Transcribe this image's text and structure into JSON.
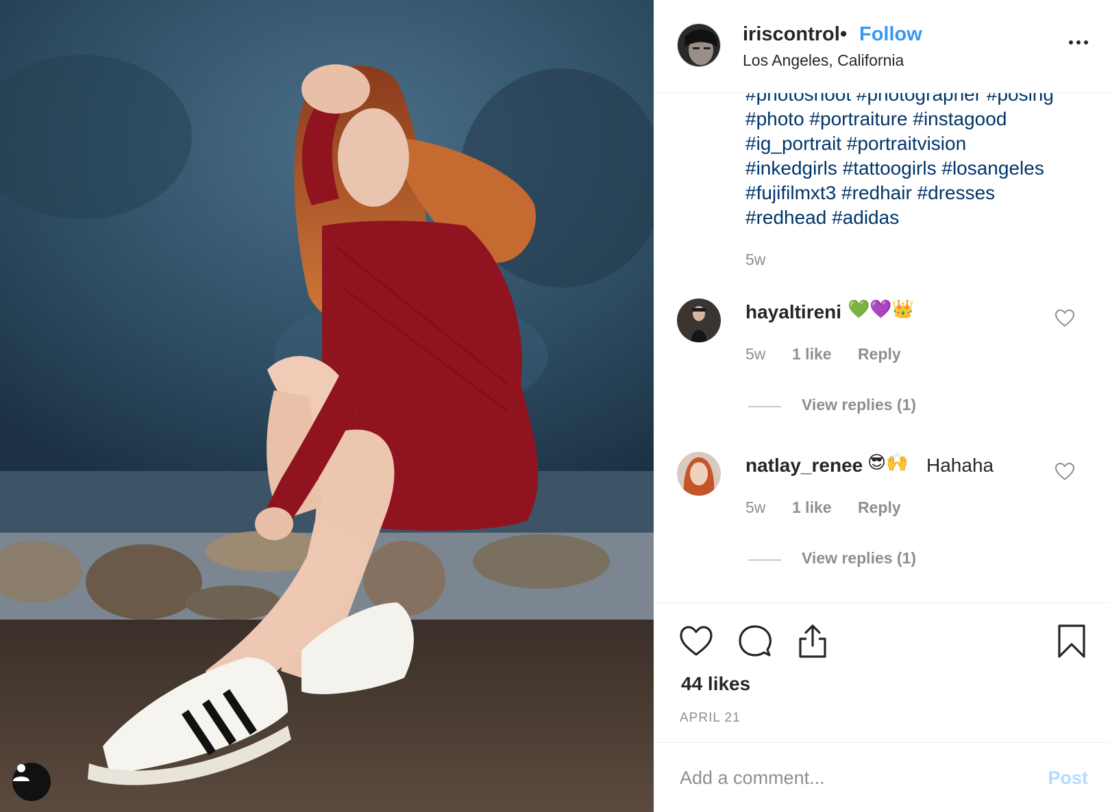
{
  "post": {
    "username": "iriscontrol",
    "separator": "•",
    "follow_label": "Follow",
    "location": "Los Angeles, California"
  },
  "caption": {
    "hashtags": [
      "#photoshoot #photographer #posing",
      "#photo #portraiture #instagood",
      "#ig_portrait #portraitvision",
      "#inkedgirls #tattoogirls #losangeles",
      "#fujifilmxt3 #redhair #dresses",
      "#redhead #adidas"
    ],
    "time": "5w"
  },
  "comments": [
    {
      "username": "hayaltireni",
      "emojis": "💚💜👑",
      "text": "",
      "time": "5w",
      "likes": "1 like",
      "reply_label": "Reply",
      "view_replies": "View replies (1)"
    },
    {
      "username": "natlay_renee",
      "emojis": "😎🙌",
      "text": "Hahaha",
      "time": "5w",
      "likes": "1 like",
      "reply_label": "Reply",
      "view_replies": "View replies (1)"
    }
  ],
  "actions": {
    "likes": "44 likes",
    "date": "APRIL 21",
    "icons": [
      "heart-icon",
      "comment-icon",
      "share-icon",
      "bookmark-icon"
    ]
  },
  "composer": {
    "placeholder": "Add a comment...",
    "post_label": "Post"
  },
  "colors": {
    "link_blue": "#3897f0",
    "hashtag": "#003569",
    "muted": "#8e8e8e",
    "post_disabled": "#b3dbff"
  }
}
